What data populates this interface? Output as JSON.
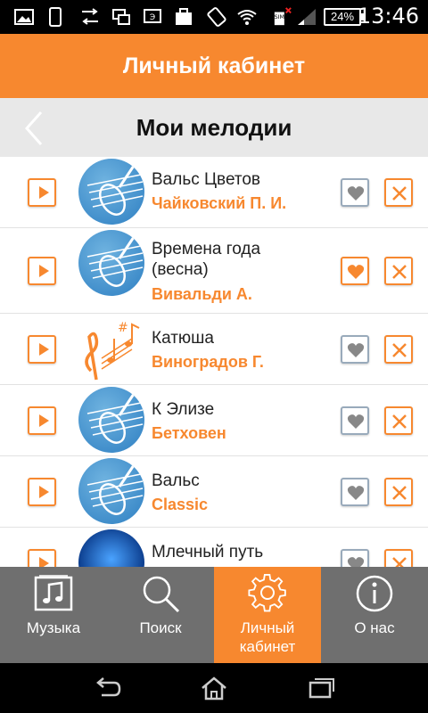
{
  "status": {
    "battery": "24%",
    "time": "13:46"
  },
  "header": {
    "title": "Личный кабинет"
  },
  "subheader": {
    "title": "Мои мелодии",
    "back_icon": "chevron-left-icon"
  },
  "songs": [
    {
      "title": "Вальс Цветов",
      "artist": "Чайковский П. И.",
      "image": "violin",
      "favorite": false
    },
    {
      "title": "Времена года\n(весна)",
      "artist": "Вивальди А.",
      "image": "violin",
      "favorite": true
    },
    {
      "title": "Катюша",
      "artist": "Виноградов Г.",
      "image": "notes",
      "favorite": false
    },
    {
      "title": "К Элизе",
      "artist": "Бетховен",
      "image": "violin",
      "favorite": false
    },
    {
      "title": "Вальс",
      "artist": "Classic",
      "image": "violin",
      "favorite": false
    },
    {
      "title": "Млечный путь",
      "artist": "",
      "image": "milky-way",
      "favorite": false
    }
  ],
  "tabs": [
    {
      "label": "Музыка",
      "icon": "music-note-icon",
      "active": false
    },
    {
      "label": "Поиск",
      "icon": "search-icon",
      "active": false
    },
    {
      "label": "Личный\nкабинет",
      "icon": "gear-icon",
      "active": true
    },
    {
      "label": "О нас",
      "icon": "info-icon",
      "active": false
    }
  ],
  "colors": {
    "accent": "#f7882f",
    "tabbar": "#6f6f6f",
    "subheader": "#e8e8e8"
  }
}
